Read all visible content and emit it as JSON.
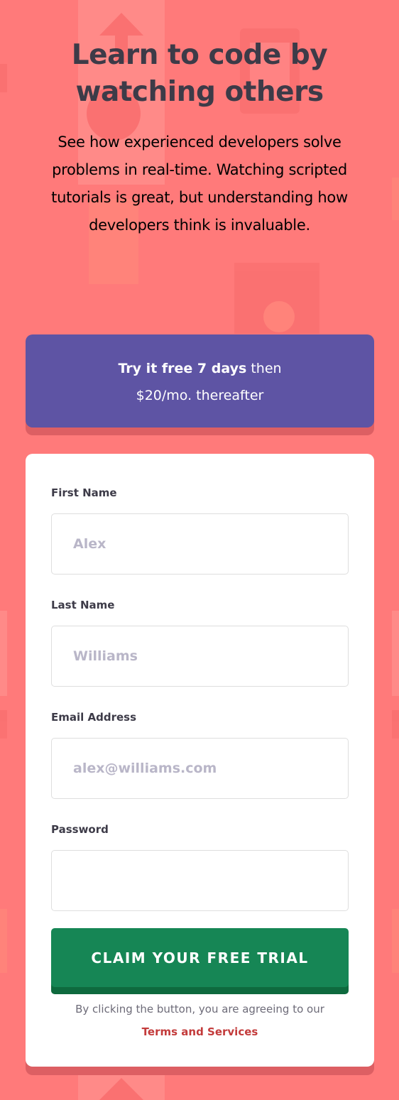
{
  "hero": {
    "title_line1": "Learn to code by",
    "title_line2": "watching others",
    "body": "See how experienced developers solve problems in real-time. Watching scripted tutorials is great, but understanding how developers think is invaluable."
  },
  "promo": {
    "highlight": "Try it free 7 days",
    "rest": "then",
    "line2": "$20/mo. thereafter"
  },
  "form": {
    "fields": [
      {
        "label": "First Name",
        "placeholder": "Alex"
      },
      {
        "label": "Last Name",
        "placeholder": "Williams"
      },
      {
        "label": "Email Address",
        "placeholder": "alex@williams.com"
      },
      {
        "label": "Password",
        "placeholder": ""
      }
    ],
    "submit_label": "CLAIM YOUR FREE TRIAL",
    "legal_text": "By clicking the button, you are agreeing to our",
    "legal_link": "Terms and Services"
  },
  "colors": {
    "background": "#ff7a7a",
    "promo": "#5e54a4",
    "submit": "#168655",
    "link": "#c33b3b",
    "heading": "#3d3b48"
  }
}
